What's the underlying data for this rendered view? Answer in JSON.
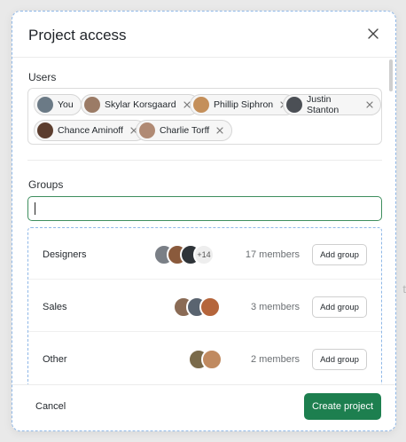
{
  "background": {
    "hint_text": "t"
  },
  "modal": {
    "title": "Project access",
    "close_icon": "close-icon"
  },
  "users": {
    "label": "Users",
    "chips": [
      {
        "name": "You",
        "removable": false,
        "avatar_color": "#6b7a86"
      },
      {
        "name": "Skylar Korsgaard",
        "removable": true,
        "avatar_color": "#9b7b66"
      },
      {
        "name": "Phillip Siphron",
        "removable": true,
        "avatar_color": "#c48f5a"
      },
      {
        "name": "Justin Stanton",
        "removable": true,
        "avatar_color": "#4b4f55"
      },
      {
        "name": "Chance Aminoff",
        "removable": true,
        "avatar_color": "#5c3d2e"
      },
      {
        "name": "Charlie Torff",
        "removable": true,
        "avatar_color": "#b08a74"
      }
    ]
  },
  "groups": {
    "label": "Groups",
    "input_value": "",
    "items": [
      {
        "name": "Designers",
        "members": "17 members",
        "extra": "+14",
        "add_label": "Add group",
        "avatar_colors": [
          "#7a7f86",
          "#8a5a3c",
          "#2e3338"
        ]
      },
      {
        "name": "Sales",
        "members": "3 members",
        "add_label": "Add group",
        "avatar_colors": [
          "#8a6b55",
          "#5a6470",
          "#b5653b"
        ]
      },
      {
        "name": "Other",
        "members": "2 members",
        "add_label": "Add group",
        "avatar_colors": [
          "#7a6a4a",
          "#c08a60"
        ]
      }
    ]
  },
  "footer": {
    "cancel_label": "Cancel",
    "create_label": "Create project",
    "primary_color": "#1d7f4f"
  }
}
